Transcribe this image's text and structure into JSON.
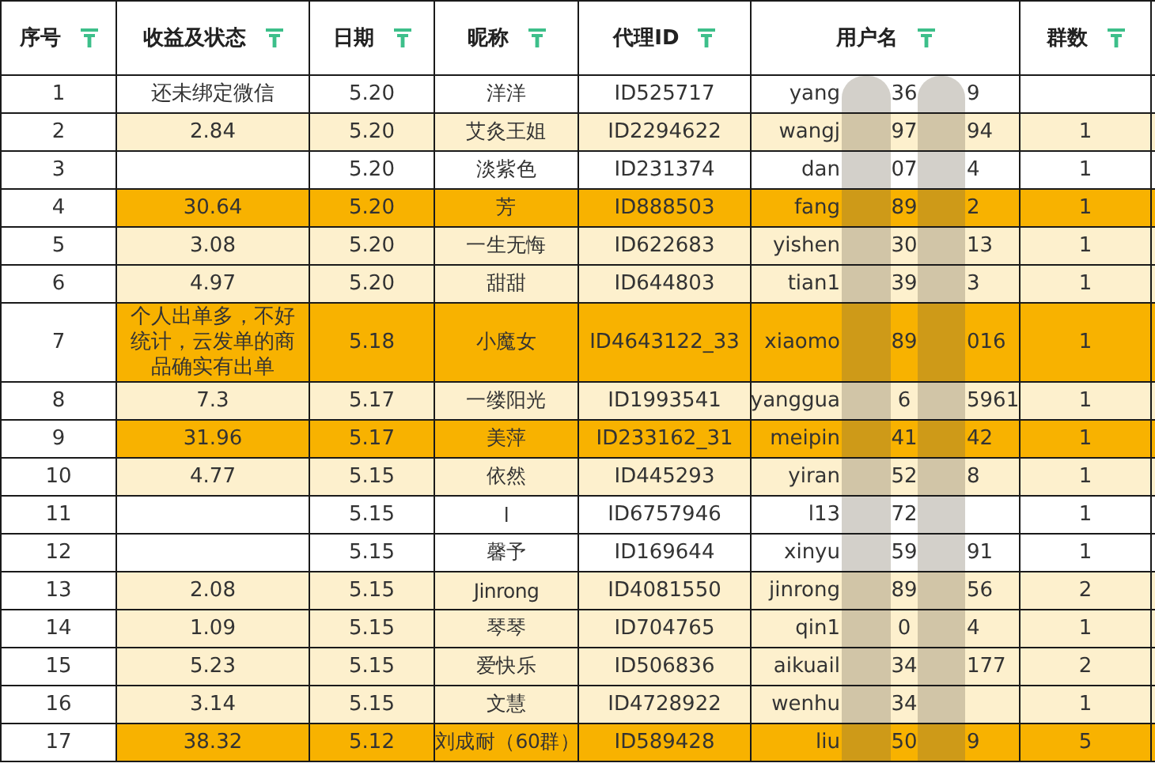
{
  "table": {
    "columns": [
      "序号",
      "收益及状态",
      "日期",
      "昵称",
      "代理ID",
      "用户名",
      "群数"
    ],
    "rows": [
      {
        "no": "1",
        "income": "还未绑定微信",
        "date": "5.20",
        "nickname": "洋洋",
        "agent_id": "ID525717",
        "username": {
          "before": "yang",
          "between": "36",
          "after": "9"
        },
        "color": "#ffffff"
      },
      {
        "no": "2",
        "income": "2.84",
        "date": "5.20",
        "nickname": "艾灸王姐",
        "agent_id": "ID2294622",
        "username": {
          "before": "wangj",
          "between": "97",
          "after": "94"
        },
        "groups": "1",
        "color": "#fdf0cd"
      },
      {
        "no": "3",
        "date": "5.20",
        "nickname": "淡紫色",
        "agent_id": "ID231374",
        "username": {
          "before": "dan",
          "between": "07",
          "after": "4"
        },
        "groups": "1",
        "color": "#ffffff"
      },
      {
        "no": "4",
        "income": "30.64",
        "date": "5.20",
        "nickname": "芳",
        "agent_id": "ID888503",
        "username": {
          "before": "fang",
          "between": "89",
          "after": "2"
        },
        "groups": "1",
        "color": "#f8b200"
      },
      {
        "no": "5",
        "income": "3.08",
        "date": "5.20",
        "nickname": "一生无悔",
        "agent_id": "ID622683",
        "username": {
          "before": "yishen",
          "between": "30",
          "after": "13"
        },
        "groups": "1",
        "color": "#fdf0cd"
      },
      {
        "no": "6",
        "income": "4.97",
        "date": "5.20",
        "nickname": "甜甜",
        "agent_id": "ID644803",
        "username": {
          "before": "tian1",
          "between": "39",
          "after": "3"
        },
        "groups": "1",
        "color": "#fdf0cd"
      },
      {
        "no": "7",
        "income": "个人出单多，不好统计，云发单的商品确实有出单",
        "date": "5.18",
        "nickname": "小魔女",
        "agent_id": "ID4643122_33",
        "username": {
          "before": "xiaomo",
          "between": "89",
          "after": "016"
        },
        "groups": "1",
        "color": "#f8b200"
      },
      {
        "no": "8",
        "income": "7.3",
        "date": "5.17",
        "nickname": "一缕阳光",
        "agent_id": "ID1993541",
        "username": {
          "before": "yanggua",
          "between": "6",
          "after": "5961"
        },
        "groups": "1",
        "color": "#fdf0cd"
      },
      {
        "no": "9",
        "income": "31.96",
        "date": "5.17",
        "nickname": "美萍",
        "agent_id": "ID233162_31",
        "username": {
          "before": "meipin",
          "between": "41",
          "after": "42"
        },
        "groups": "1",
        "color": "#f8b200"
      },
      {
        "no": "10",
        "income": "4.77",
        "date": "5.15",
        "nickname": "依然",
        "agent_id": "ID445293",
        "username": {
          "before": "yiran",
          "between": "52",
          "after": "8"
        },
        "groups": "1",
        "color": "#fdf0cd"
      },
      {
        "no": "11",
        "date": "5.15",
        "nickname": "l",
        "agent_id": "ID6757946",
        "username": {
          "before": "l13",
          "between": "72"
        },
        "groups": "1",
        "color": "#ffffff"
      },
      {
        "no": "12",
        "date": "5.15",
        "nickname": "馨予",
        "agent_id": "ID169644",
        "username": {
          "before": "xinyu",
          "between": "59",
          "after": "91"
        },
        "groups": "1",
        "color": "#ffffff"
      },
      {
        "no": "13",
        "income": "2.08",
        "date": "5.15",
        "nickname": "Jinrong",
        "agent_id": "ID4081550",
        "username": {
          "before": "jinrong",
          "between": "89",
          "after": "56"
        },
        "groups": "2",
        "color": "#fdf0cd"
      },
      {
        "no": "14",
        "income": "1.09",
        "date": "5.15",
        "nickname": "琴琴",
        "agent_id": "ID704765",
        "username": {
          "before": "qin1",
          "between": "0",
          "after": "4"
        },
        "groups": "1",
        "color": "#fdf0cd"
      },
      {
        "no": "15",
        "income": "5.23",
        "date": "5.15",
        "nickname": "爱快乐",
        "agent_id": "ID506836",
        "username": {
          "before": "aikuail",
          "between": "34",
          "after": "177"
        },
        "groups": "2",
        "color": "#fdf0cd"
      },
      {
        "no": "16",
        "income": "3.14",
        "date": "5.15",
        "nickname": "文慧",
        "agent_id": "ID4728922",
        "username": {
          "before": "wenhu",
          "between": "34"
        },
        "groups": "1",
        "color": "#fdf0cd"
      },
      {
        "no": "17",
        "income": "38.32",
        "date": "5.12",
        "nickname": "刘成耐（60群）",
        "agent_id": "ID589428",
        "username": {
          "before": "liu",
          "between": "50",
          "after": "9"
        },
        "groups": "5",
        "color": "#f8b200"
      }
    ]
  }
}
